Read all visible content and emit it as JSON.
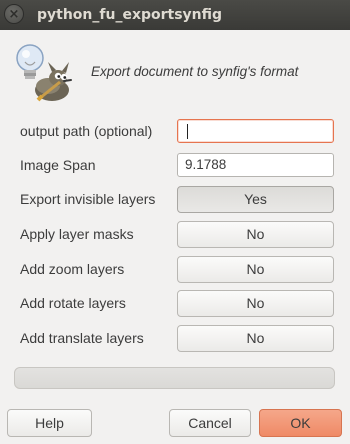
{
  "window": {
    "title": "python_fu_exportsynfig",
    "close_glyph": "×"
  },
  "header": {
    "icon": "gimp-wilber-lightbulb-icon",
    "description": "Export document to synfig's format"
  },
  "rows": [
    {
      "label": "output path (optional)",
      "value": ""
    },
    {
      "label": "Image Span",
      "value": "9.1788"
    },
    {
      "label": "Export invisible layers",
      "value": "Yes"
    },
    {
      "label": "Apply layer masks",
      "value": "No"
    },
    {
      "label": "Add zoom layers",
      "value": "No"
    },
    {
      "label": "Add rotate layers",
      "value": "No"
    },
    {
      "label": "Add translate layers",
      "value": "No"
    }
  ],
  "progress": {
    "value": 0
  },
  "buttons": {
    "help": "Help",
    "cancel": "Cancel",
    "ok": "OK"
  },
  "colors": {
    "accent": "#ef8a66",
    "focus_border": "#e6744f",
    "titlebar": "#3c3b37"
  }
}
